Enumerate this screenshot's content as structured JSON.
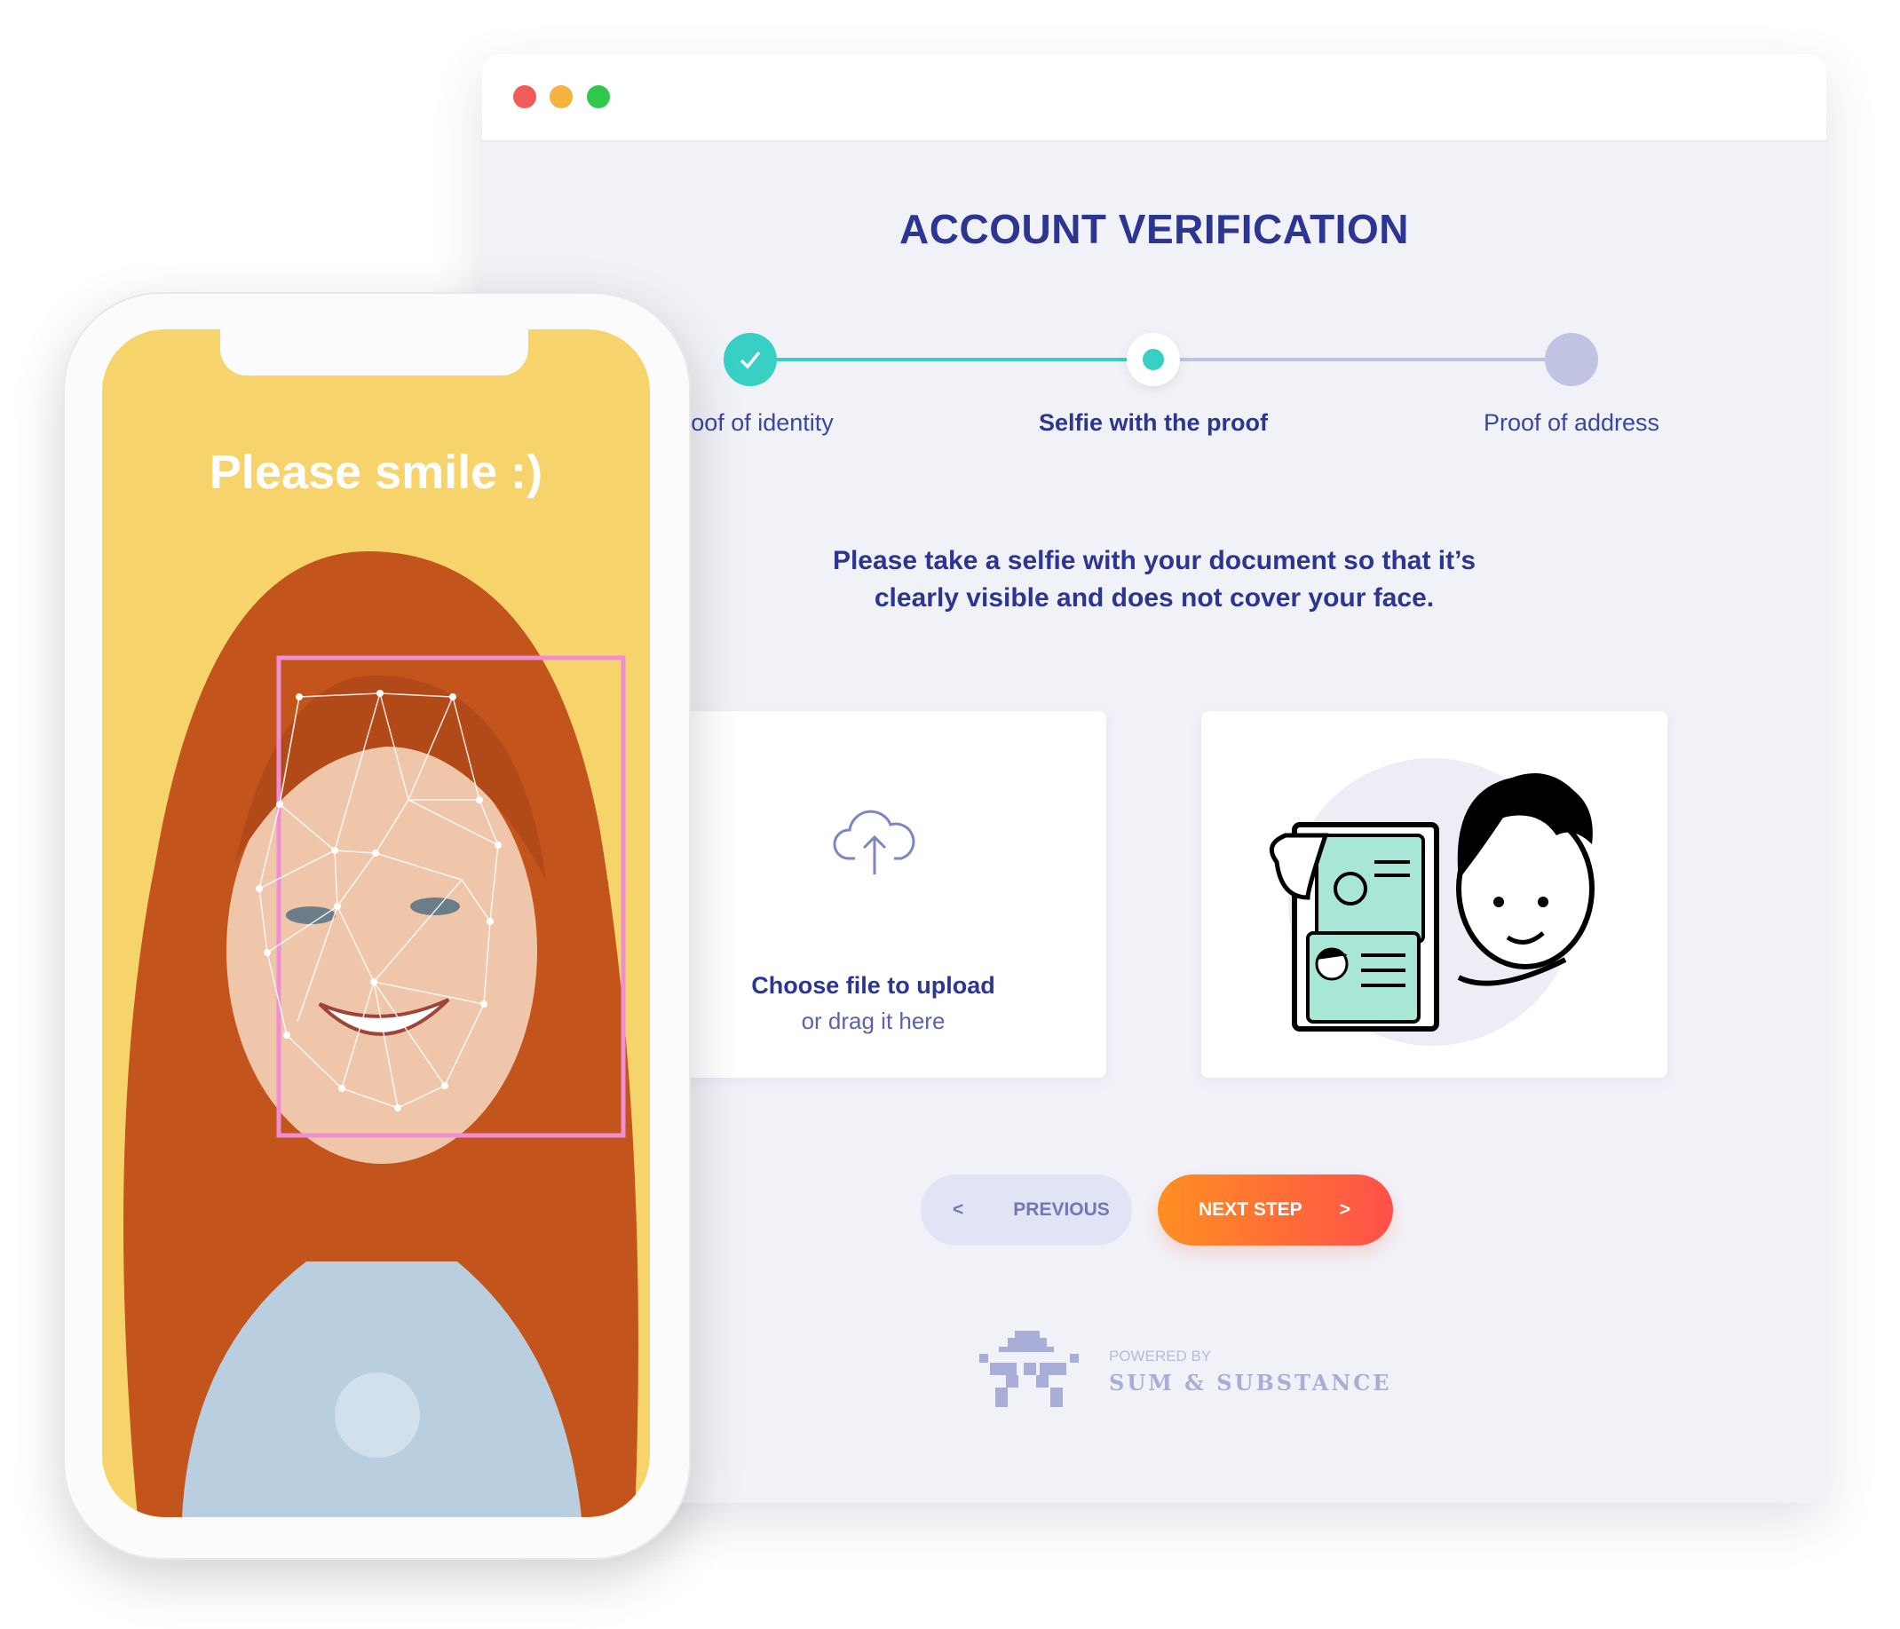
{
  "window": {
    "traffic_lights": [
      "#f15b58",
      "#f4b23e",
      "#2fc84a"
    ]
  },
  "header": {
    "title": "ACCOUNT VERIFICATION"
  },
  "stepper": {
    "steps": [
      {
        "label": "Proof of identity",
        "state": "completed"
      },
      {
        "label": "Selfie with the proof",
        "state": "active"
      },
      {
        "label": "Proof of address",
        "state": "pending"
      }
    ],
    "accent": "#38cfc4",
    "pending": "#c0c4e2"
  },
  "instruction": {
    "line1": "Please take a selfie with your document so that it’s",
    "line2": "clearly visible and does not cover your face."
  },
  "upload": {
    "title": "Choose file to upload",
    "subtitle": "or drag it here",
    "icon": "cloud-upload-icon"
  },
  "nav": {
    "previous_label": "PREVIOUS",
    "previous_arrow": "<",
    "next_label": "NEXT STEP",
    "next_arrow": ">"
  },
  "footer": {
    "powered_by": "POWERED BY",
    "brand": "SUM & SUBSTANCE"
  },
  "phone": {
    "prompt": "Please smile :)"
  }
}
